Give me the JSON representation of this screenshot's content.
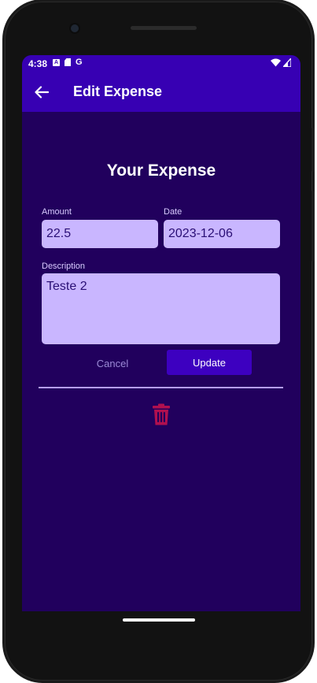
{
  "status_bar": {
    "time": "4:38",
    "icons": [
      "a-notification-icon",
      "sd-card-icon",
      "google-icon",
      "wifi-icon",
      "signal-icon"
    ],
    "google_glyph": "G"
  },
  "app_bar": {
    "title": "Edit Expense",
    "back_icon": "arrow-back-icon"
  },
  "form": {
    "heading": "Your Expense",
    "amount": {
      "label": "Amount",
      "value": "22.5"
    },
    "date": {
      "label": "Date",
      "value": "2023-12-06"
    },
    "description": {
      "label": "Description",
      "value": "Teste 2"
    },
    "cancel_label": "Cancel",
    "update_label": "Update",
    "delete_icon": "trash-icon"
  },
  "colors": {
    "app_bar": "#3700b3",
    "background": "#21005d",
    "field": "#c9b6ff",
    "button": "#3d00c0",
    "delete": "#b0104f"
  }
}
